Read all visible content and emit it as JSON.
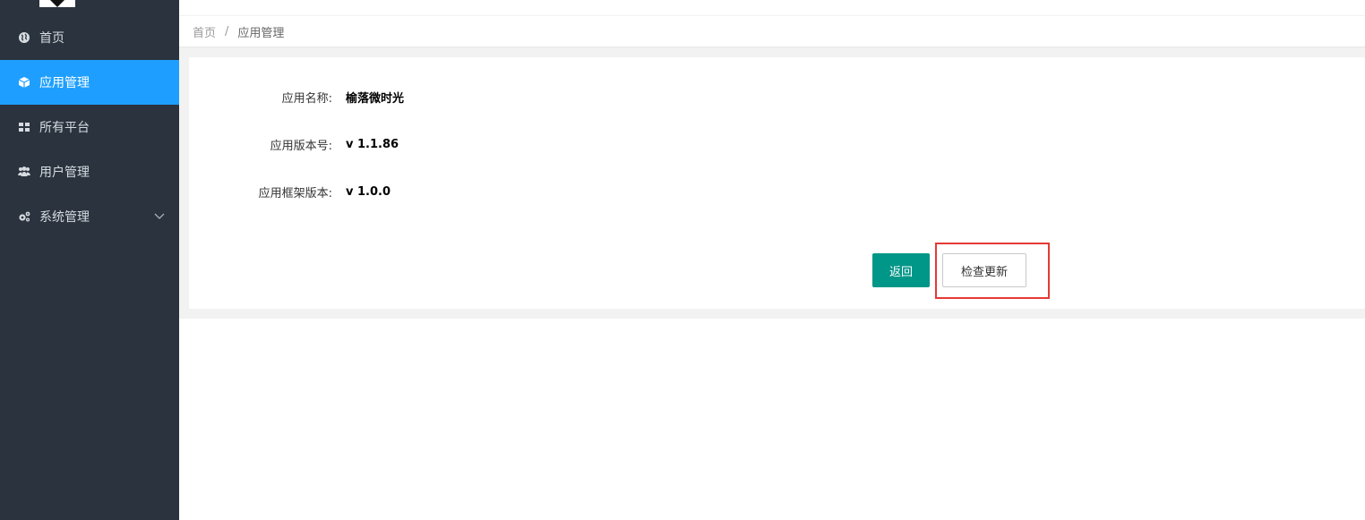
{
  "sidebar": {
    "items": [
      {
        "label": "首页",
        "icon": "globe-icon"
      },
      {
        "label": "应用管理",
        "icon": "cube-icon",
        "active": true
      },
      {
        "label": "所有平台",
        "icon": "grid-icon"
      },
      {
        "label": "用户管理",
        "icon": "users-icon"
      },
      {
        "label": "系统管理",
        "icon": "cogs-icon",
        "expandable": true
      }
    ]
  },
  "breadcrumb": {
    "home": "首页",
    "separator": "/",
    "current": "应用管理"
  },
  "app_info": {
    "name_label": "应用名称:",
    "name_value": "榆落微时光",
    "version_label": "应用版本号:",
    "version_value": "v 1.1.86",
    "framework_label": "应用框架版本:",
    "framework_value": "v 1.0.0"
  },
  "actions": {
    "back_label": "返回",
    "check_update_label": "检查更新"
  },
  "colors": {
    "sidebar_bg": "#2a333e",
    "active_item": "#1e9fff",
    "primary_button": "#009688",
    "highlight_border": "#e53935"
  }
}
